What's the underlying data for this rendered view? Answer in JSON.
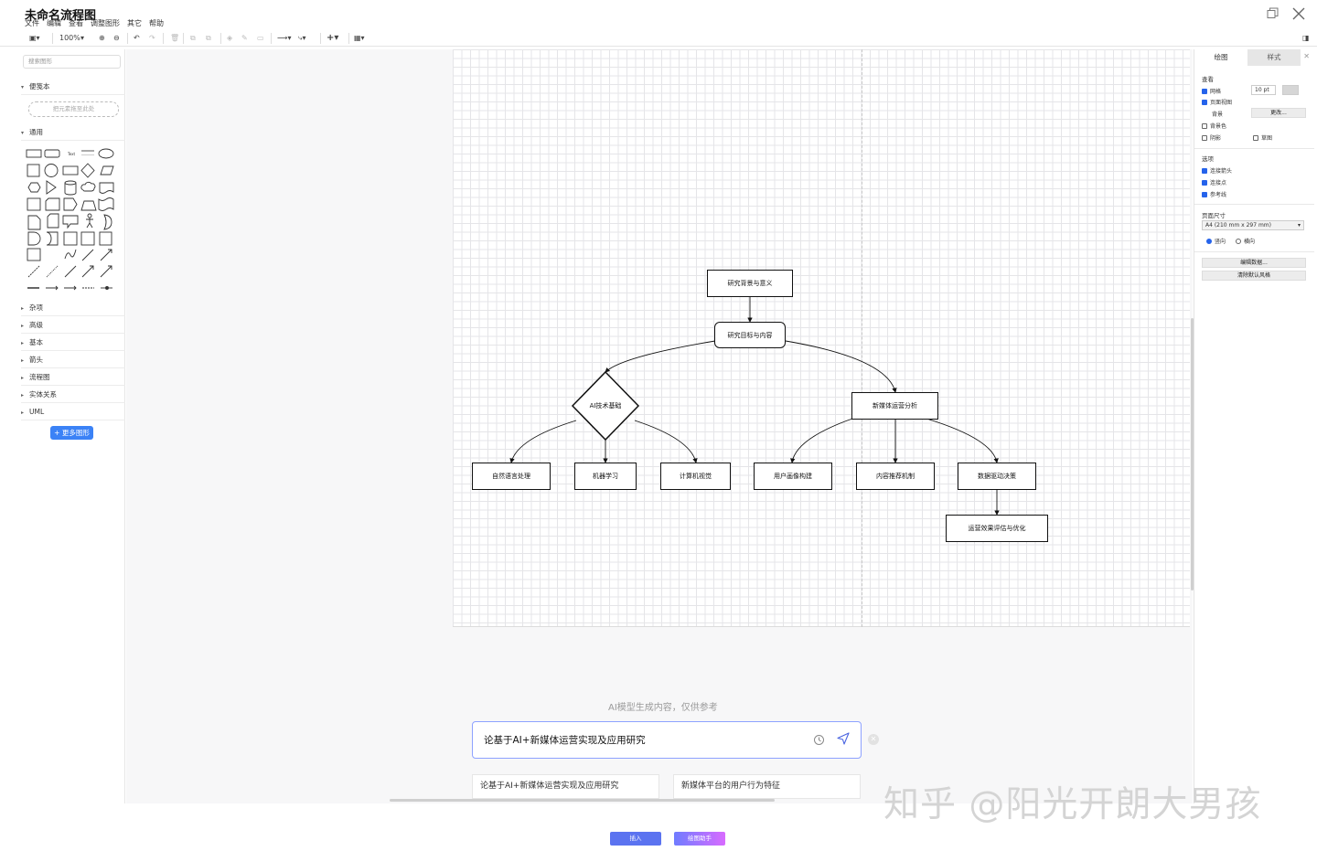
{
  "app": {
    "title": "未命名流程图",
    "menu": [
      "文件",
      "编辑",
      "查看",
      "调整图形",
      "其它",
      "帮助"
    ]
  },
  "toolbar": {
    "zoom": "100%"
  },
  "left_panel": {
    "search_placeholder": "搜索图形",
    "scratchpad": {
      "label": "便笺本",
      "dropzone": "把元素拖至此处"
    },
    "general": {
      "label": "通用"
    },
    "collapsed_sections": [
      "杂项",
      "高级",
      "基本",
      "箭头",
      "流程图",
      "实体关系",
      "UML"
    ],
    "more_shapes": "+ 更多图形"
  },
  "diagram": {
    "nodes": {
      "n1": "研究背景与意义",
      "n2": "研究目标与内容",
      "n3": "AI技术基础",
      "n4": "新媒体运营分析",
      "n5": "自然语言处理",
      "n6": "机器学习",
      "n7": "计算机视觉",
      "n8": "用户画像构建",
      "n9": "内容推荐机制",
      "n10": "数据驱动决策",
      "n11": "运营效果评估与优化"
    }
  },
  "right_panel": {
    "tabs": [
      "绘图",
      "样式"
    ],
    "view_heading": "查看",
    "grid": {
      "label": "网格",
      "checked": true,
      "size": "10 pt"
    },
    "page_view": {
      "label": "页面视图",
      "checked": true
    },
    "background": {
      "label": "背景",
      "button": "更改..."
    },
    "background_color": {
      "label": "背景色",
      "checked": false
    },
    "shadow": {
      "label": "阴影",
      "checked": false
    },
    "sketch": {
      "label": "草图",
      "checked": false
    },
    "options_heading": "选项",
    "connection_arrows": {
      "label": "连接箭头",
      "checked": true
    },
    "connection_points": {
      "label": "连接点",
      "checked": true
    },
    "guides": {
      "label": "参考线",
      "checked": true
    },
    "page_size_heading": "页面尺寸",
    "page_size": "A4 (210 mm x 297 mm)",
    "portrait": "竖向",
    "landscape": "横向",
    "edit_data": "编辑数据...",
    "clear_style": "清除默认风格"
  },
  "ai": {
    "disclaimer": "AI模型生成内容，仅供参考",
    "input_value": "论基于AI+新媒体运营实现及应用研究",
    "suggestions": [
      "论基于AI+新媒体运营实现及应用研究",
      "新媒体平台的用户行为特征"
    ],
    "insert_button": "插入",
    "assistant_button": "绘图助手"
  },
  "watermark": "知乎 @阳光开朗大男孩",
  "colors": {
    "primary": "#3b82f6",
    "input_border": "#8ea2ff",
    "assistant_gradient_start": "#6f7cff",
    "assistant_gradient_end": "#d86bff"
  }
}
